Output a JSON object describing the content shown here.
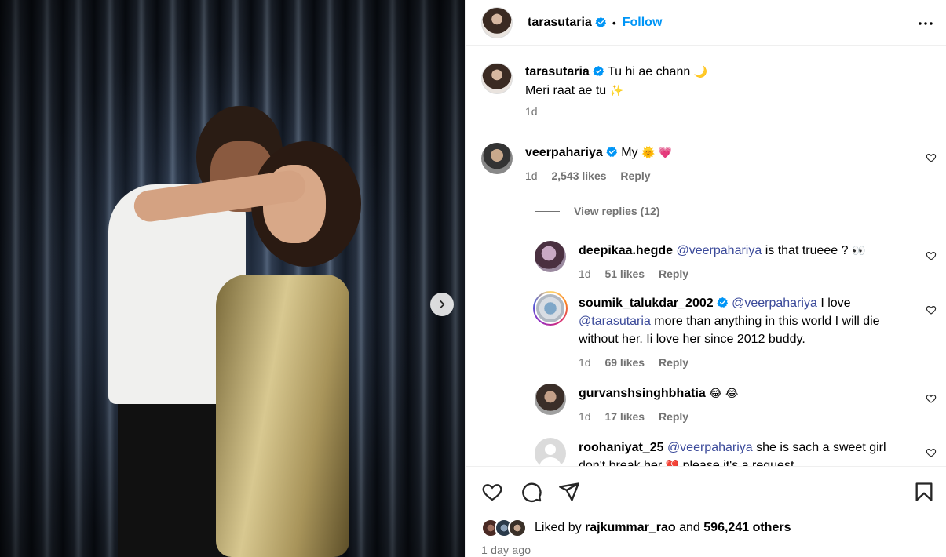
{
  "post": {
    "author": "tarasutaria",
    "follow_label": "Follow",
    "separator": "•",
    "caption_line1": "Tu hi ae chann",
    "caption_line1_emoji": "🌙",
    "caption_line2": "Meri raat ae tu",
    "caption_line2_emoji": "✨",
    "caption_age": "1d"
  },
  "comments": [
    {
      "username": "veerpahariya",
      "verified": true,
      "text": "My",
      "emoji": "🌞 💗",
      "age": "1d",
      "likes": "2,543 likes",
      "reply": "Reply",
      "view_replies": "View replies (12)"
    }
  ],
  "replies": [
    {
      "username": "deepikaa.hegde",
      "mention": "@veerpahariya",
      "text": "is that trueee ?",
      "emoji": "👀",
      "age": "1d",
      "likes": "51 likes",
      "reply": "Reply"
    },
    {
      "username": "soumik_talukdar_2002",
      "verified": true,
      "mention": "@veerpahariya",
      "text_a": "I love",
      "mention2": "@tarasutaria",
      "text_b": "more than anything in this world I will die without her. Ii love her since 2012 buddy.",
      "age": "1d",
      "likes": "69 likes",
      "reply": "Reply"
    },
    {
      "username": "gurvanshsinghbhatia",
      "emoji": "😂 😂",
      "age": "1d",
      "likes": "17 likes",
      "reply": "Reply"
    },
    {
      "username": "roohaniyat_25",
      "mention": "@veerpahariya",
      "text": "she is sach a sweet girl don't break her",
      "emoji": "💔",
      "text_tail": "please it's a request"
    }
  ],
  "footer": {
    "liked_by_prefix": "Liked by",
    "liked_by_user": "rajkummar_rao",
    "liked_by_and": "and",
    "liked_by_others": "596,241 others",
    "time_ago": "1 day ago"
  },
  "icons": {
    "heart": "heart-icon",
    "comment": "comment-icon",
    "share": "share-icon",
    "save": "bookmark-icon",
    "more": "more-icon",
    "next": "chevron-right-icon",
    "verified": "verified-badge-icon"
  },
  "colors": {
    "follow": "#0095f6",
    "verified": "#0095f6",
    "mention": "#3b4a9a",
    "meta": "#737373"
  }
}
